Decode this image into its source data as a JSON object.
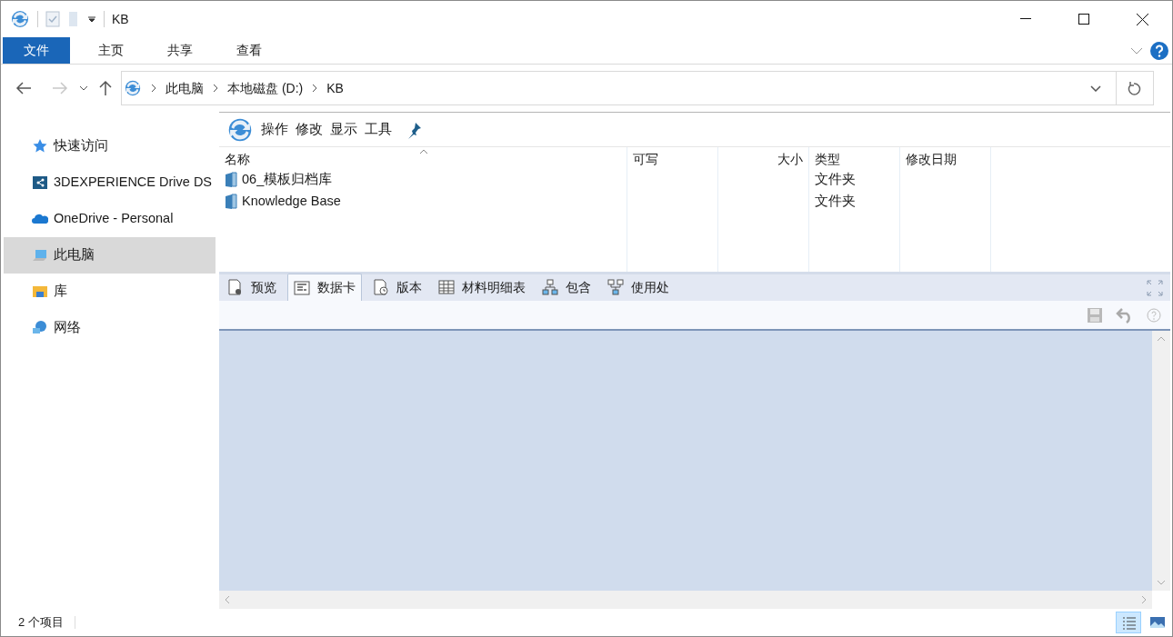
{
  "window": {
    "title": "KB"
  },
  "ribbon_tabs": [
    {
      "label": "文件",
      "selected": true
    },
    {
      "label": "主页",
      "selected": false
    },
    {
      "label": "共享",
      "selected": false
    },
    {
      "label": "查看",
      "selected": false
    }
  ],
  "breadcrumb": [
    "此电脑",
    "本地磁盘 (D:)",
    "KB"
  ],
  "sidebar": {
    "items": [
      {
        "label": "快速访问",
        "kind": "star",
        "selected": false
      },
      {
        "label": "3DEXPERIENCE Drive DS",
        "kind": "drive",
        "selected": false
      },
      {
        "label": "OneDrive - Personal",
        "kind": "cloud",
        "selected": false
      },
      {
        "label": "此电脑",
        "kind": "computer",
        "selected": true
      },
      {
        "label": "库",
        "kind": "library",
        "selected": false
      },
      {
        "label": "网络",
        "kind": "network",
        "selected": false
      }
    ]
  },
  "pdm_menu": [
    "操作",
    "修改",
    "显示",
    "工具"
  ],
  "table": {
    "columns": [
      {
        "label": "名称"
      },
      {
        "label": "可写"
      },
      {
        "label": "大小"
      },
      {
        "label": "类型"
      },
      {
        "label": "修改日期"
      }
    ],
    "rows": [
      {
        "name": "06_模板归档库",
        "type": "文件夹"
      },
      {
        "name": "Knowledge Base",
        "type": "文件夹"
      }
    ]
  },
  "bottom_tabs": [
    {
      "label": "预览",
      "kind": "preview",
      "selected": false
    },
    {
      "label": "数据卡",
      "kind": "datacard",
      "selected": true
    },
    {
      "label": "版本",
      "kind": "version",
      "selected": false
    },
    {
      "label": "材料明细表",
      "kind": "bom",
      "selected": false
    },
    {
      "label": "包含",
      "kind": "contains",
      "selected": false
    },
    {
      "label": "使用处",
      "kind": "whereused",
      "selected": false
    }
  ],
  "status_bar": {
    "text": "2 个项目"
  },
  "view_buttons": [
    {
      "kind": "details",
      "selected": true
    },
    {
      "kind": "thumbnails",
      "selected": false
    }
  ]
}
